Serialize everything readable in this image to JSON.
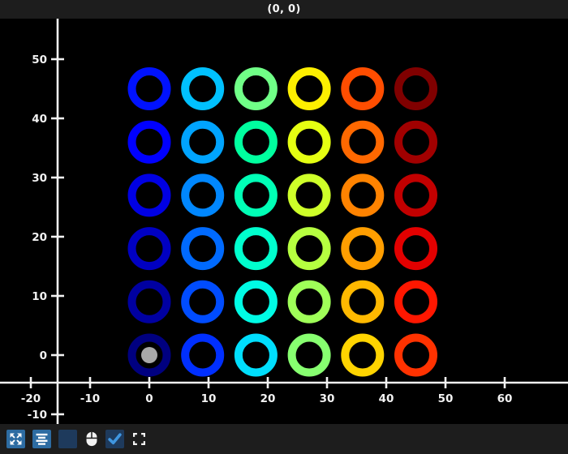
{
  "title_bar": {
    "title": "(0, 0)"
  },
  "chart_data": {
    "type": "scatter",
    "title": "(0, 0)",
    "marker_style": "open-circle",
    "colormap": "jet",
    "x_ticks": [
      -20,
      -10,
      0,
      10,
      20,
      30,
      40,
      50,
      60
    ],
    "y_ticks": [
      50,
      40,
      30,
      20,
      10,
      0,
      -10
    ],
    "x_range": [
      -25,
      71
    ],
    "y_range": [
      -12,
      57
    ],
    "grid": false,
    "background": "#000000",
    "axis_color": "#f2f2f2",
    "points": [
      [
        0,
        0,
        "#000080"
      ],
      [
        0,
        9,
        "#0000a1"
      ],
      [
        0,
        18,
        "#0000c2"
      ],
      [
        0,
        27,
        "#0000e3"
      ],
      [
        0,
        36,
        "#0000ff"
      ],
      [
        0,
        45,
        "#0012ff"
      ],
      [
        9,
        0,
        "#002fff"
      ],
      [
        9,
        9,
        "#004cff"
      ],
      [
        9,
        18,
        "#006aff"
      ],
      [
        9,
        27,
        "#0087ff"
      ],
      [
        9,
        36,
        "#00a4ff"
      ],
      [
        9,
        45,
        "#00c1ff"
      ],
      [
        18,
        0,
        "#00defd"
      ],
      [
        18,
        9,
        "#00fbe5"
      ],
      [
        18,
        18,
        "#00ffce"
      ],
      [
        18,
        27,
        "#00ffb6"
      ],
      [
        18,
        36,
        "#00ff9f"
      ],
      [
        18,
        45,
        "#70ff87"
      ],
      [
        27,
        0,
        "#87ff70"
      ],
      [
        27,
        9,
        "#9fff58"
      ],
      [
        27,
        18,
        "#b6ff40"
      ],
      [
        27,
        27,
        "#ceff29"
      ],
      [
        27,
        36,
        "#e5ff12"
      ],
      [
        27,
        45,
        "#fdef00"
      ],
      [
        36,
        0,
        "#ffd400"
      ],
      [
        36,
        9,
        "#ffb900"
      ],
      [
        36,
        18,
        "#ff9e00"
      ],
      [
        36,
        27,
        "#ff8300"
      ],
      [
        36,
        36,
        "#ff6800"
      ],
      [
        36,
        45,
        "#ff4d00"
      ],
      [
        45,
        0,
        "#ff3200"
      ],
      [
        45,
        9,
        "#ff1700"
      ],
      [
        45,
        18,
        "#e30000"
      ],
      [
        45,
        27,
        "#c20000"
      ],
      [
        45,
        36,
        "#a10000"
      ],
      [
        45,
        45,
        "#800000"
      ]
    ],
    "selected_point": {
      "x": 0,
      "y": 0,
      "dot_color": "#a9a9a9"
    }
  },
  "toolbar": {
    "background": "#1d1d1d",
    "buttons": [
      {
        "name": "pan-button",
        "icon": "move-arrows-icon",
        "bg": "#2d6ca2"
      },
      {
        "name": "align-center-button",
        "icon": "align-center-icon",
        "bg": "#2d6ca2"
      },
      {
        "name": "inactive-toggle",
        "icon": "",
        "bg": "#1e3a5c"
      },
      {
        "name": "mouse-indicator",
        "icon": "mouse-icon",
        "bg": ""
      },
      {
        "name": "confirm-checkbox",
        "icon": "check-icon",
        "bg": "#1e3a5c",
        "checked": true,
        "check_color": "#3f96e0"
      },
      {
        "name": "fullscreen-button",
        "icon": "fullscreen-icon",
        "bg": ""
      }
    ]
  }
}
